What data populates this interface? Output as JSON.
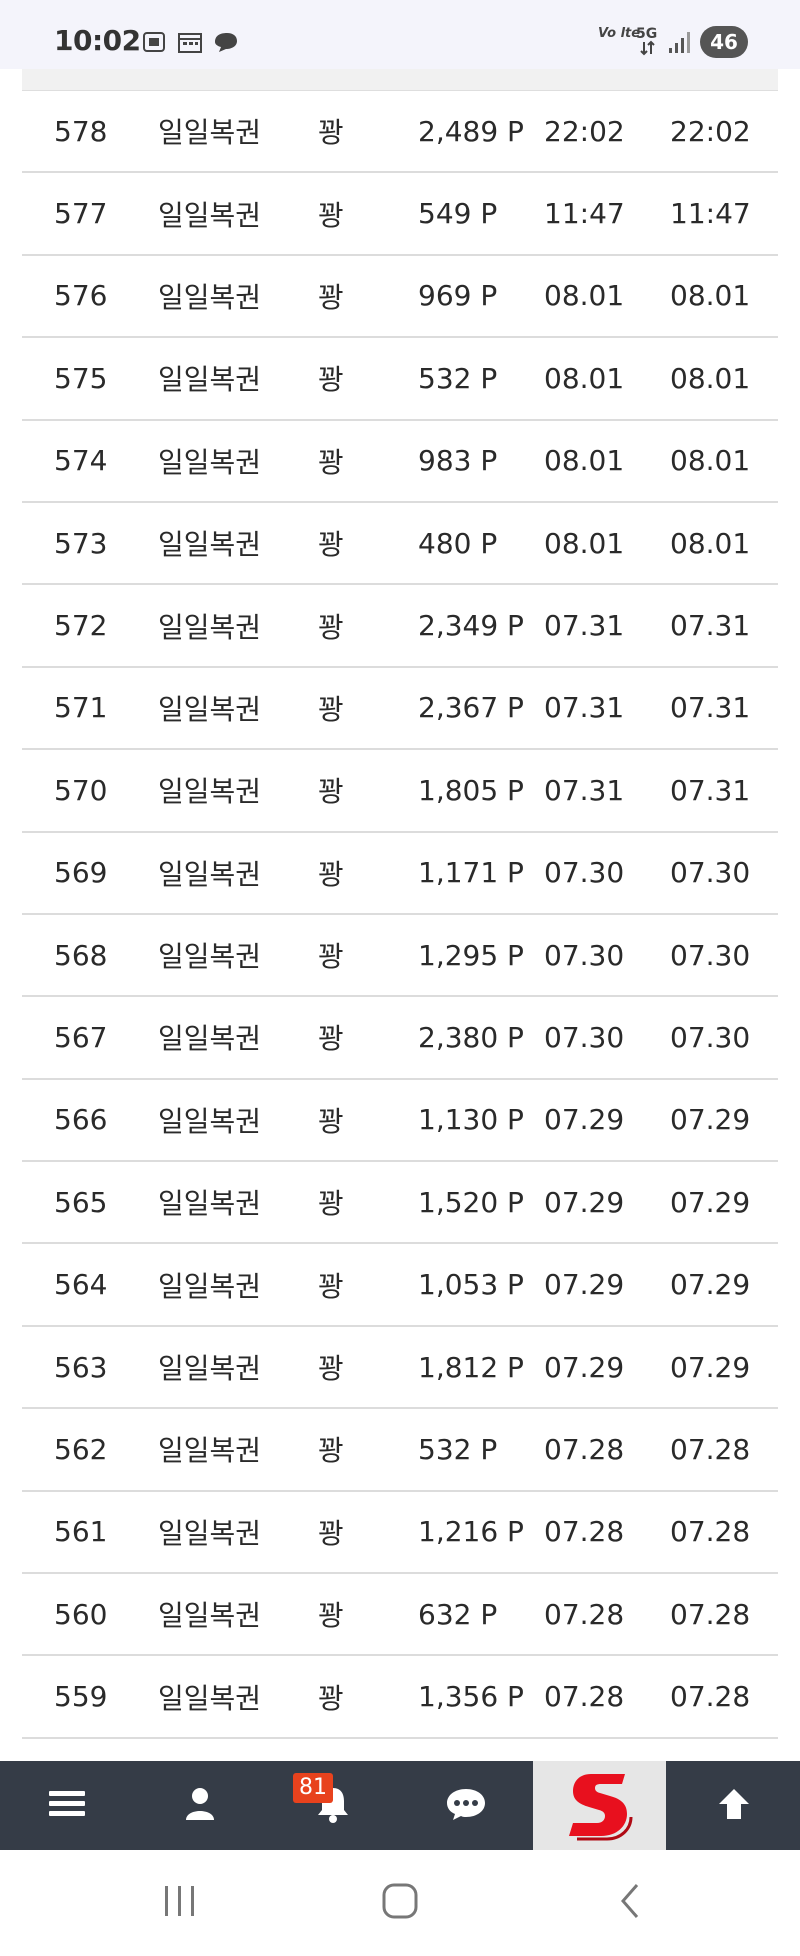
{
  "status_bar": {
    "time": "10:02",
    "network": "5G",
    "battery": "46"
  },
  "table": {
    "rows": [
      {
        "num": "578",
        "name": "일일복권",
        "result": "꽝",
        "point": "2,489 P",
        "date1": "22:02",
        "date2": "22:02"
      },
      {
        "num": "577",
        "name": "일일복권",
        "result": "꽝",
        "point": "549 P",
        "date1": "11:47",
        "date2": "11:47"
      },
      {
        "num": "576",
        "name": "일일복권",
        "result": "꽝",
        "point": "969 P",
        "date1": "08.01",
        "date2": "08.01"
      },
      {
        "num": "575",
        "name": "일일복권",
        "result": "꽝",
        "point": "532 P",
        "date1": "08.01",
        "date2": "08.01"
      },
      {
        "num": "574",
        "name": "일일복권",
        "result": "꽝",
        "point": "983 P",
        "date1": "08.01",
        "date2": "08.01"
      },
      {
        "num": "573",
        "name": "일일복권",
        "result": "꽝",
        "point": "480 P",
        "date1": "08.01",
        "date2": "08.01"
      },
      {
        "num": "572",
        "name": "일일복권",
        "result": "꽝",
        "point": "2,349 P",
        "date1": "07.31",
        "date2": "07.31"
      },
      {
        "num": "571",
        "name": "일일복권",
        "result": "꽝",
        "point": "2,367 P",
        "date1": "07.31",
        "date2": "07.31"
      },
      {
        "num": "570",
        "name": "일일복권",
        "result": "꽝",
        "point": "1,805 P",
        "date1": "07.31",
        "date2": "07.31"
      },
      {
        "num": "569",
        "name": "일일복권",
        "result": "꽝",
        "point": "1,171 P",
        "date1": "07.30",
        "date2": "07.30"
      },
      {
        "num": "568",
        "name": "일일복권",
        "result": "꽝",
        "point": "1,295 P",
        "date1": "07.30",
        "date2": "07.30"
      },
      {
        "num": "567",
        "name": "일일복권",
        "result": "꽝",
        "point": "2,380 P",
        "date1": "07.30",
        "date2": "07.30"
      },
      {
        "num": "566",
        "name": "일일복권",
        "result": "꽝",
        "point": "1,130 P",
        "date1": "07.29",
        "date2": "07.29"
      },
      {
        "num": "565",
        "name": "일일복권",
        "result": "꽝",
        "point": "1,520 P",
        "date1": "07.29",
        "date2": "07.29"
      },
      {
        "num": "564",
        "name": "일일복권",
        "result": "꽝",
        "point": "1,053 P",
        "date1": "07.29",
        "date2": "07.29"
      },
      {
        "num": "563",
        "name": "일일복권",
        "result": "꽝",
        "point": "1,812 P",
        "date1": "07.29",
        "date2": "07.29"
      },
      {
        "num": "562",
        "name": "일일복권",
        "result": "꽝",
        "point": "532 P",
        "date1": "07.28",
        "date2": "07.28"
      },
      {
        "num": "561",
        "name": "일일복권",
        "result": "꽝",
        "point": "1,216 P",
        "date1": "07.28",
        "date2": "07.28"
      },
      {
        "num": "560",
        "name": "일일복권",
        "result": "꽝",
        "point": "632 P",
        "date1": "07.28",
        "date2": "07.28"
      },
      {
        "num": "559",
        "name": "일일복권",
        "result": "꽝",
        "point": "1,356 P",
        "date1": "07.28",
        "date2": "07.28"
      }
    ]
  },
  "bottom_nav": {
    "notification_count": "81",
    "items": [
      "menu-icon",
      "user-icon",
      "bell-icon",
      "chat-icon",
      "site-logo",
      "arrow-up-icon"
    ],
    "logo_color": "#e8101e"
  },
  "system_nav": {
    "items": [
      "recents-icon",
      "home-icon",
      "back-icon"
    ]
  }
}
